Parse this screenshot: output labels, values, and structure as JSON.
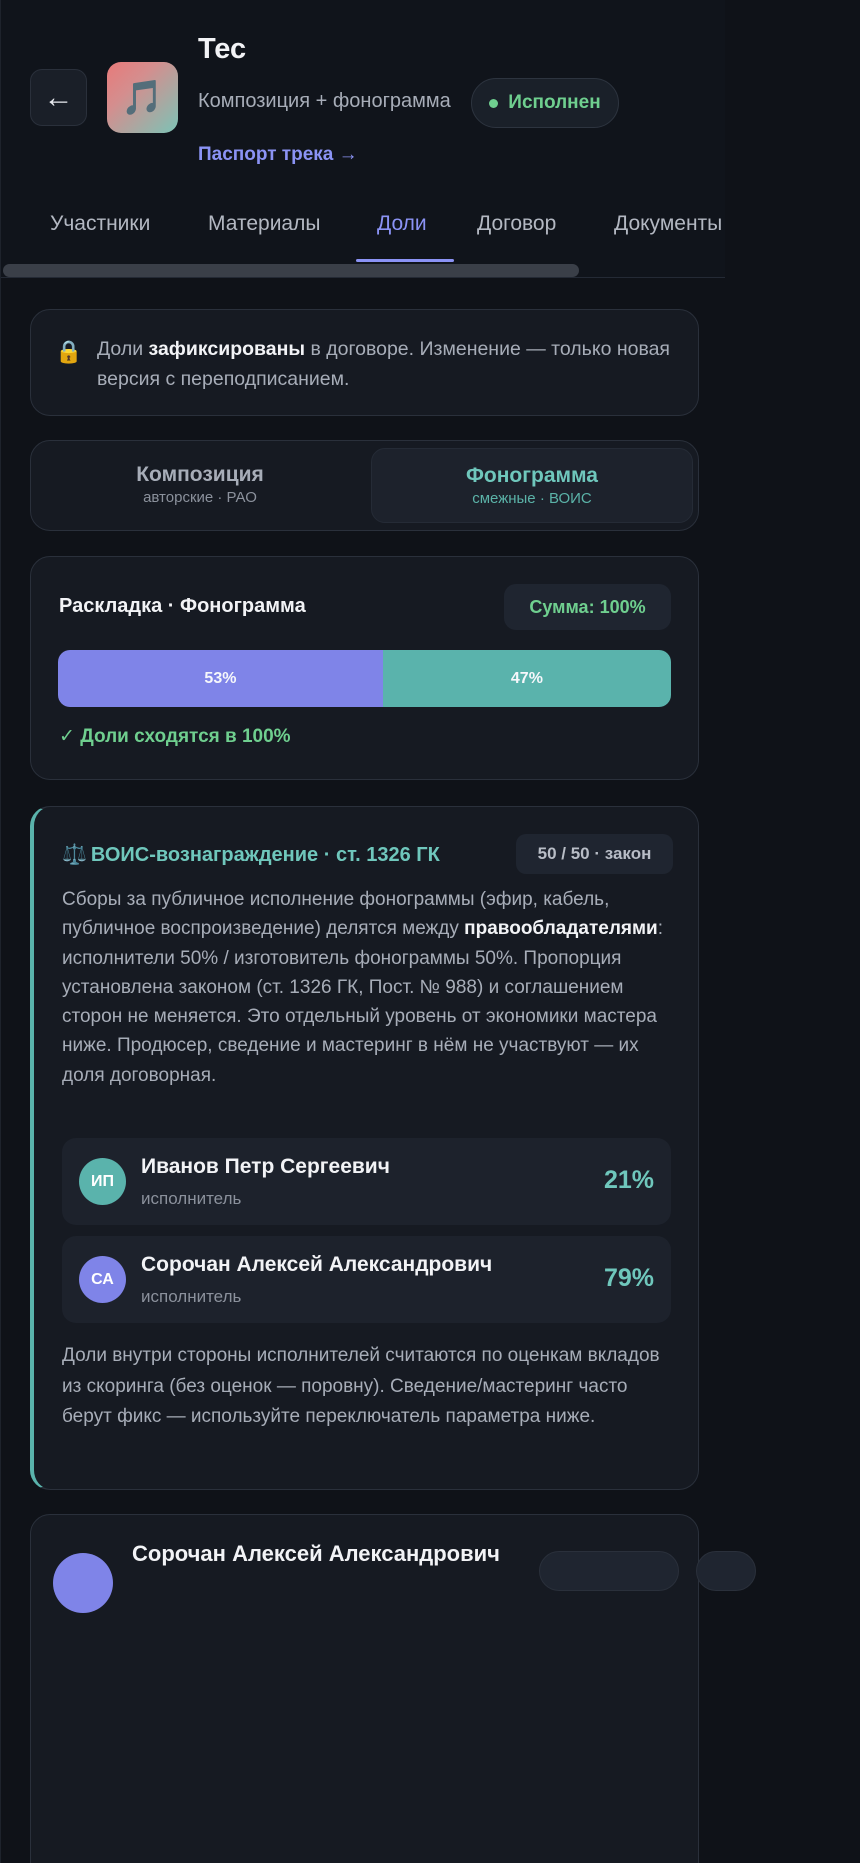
{
  "header": {
    "back_icon": "←",
    "cover_icon": "🎵",
    "title": "Тес",
    "type": "Композиция + фонограмма",
    "status": "Исполнен",
    "passport_link": "Паспорт трека →"
  },
  "tabs": [
    {
      "label": "Участники",
      "active": false
    },
    {
      "label": "Материалы",
      "active": false
    },
    {
      "label": "Доли",
      "active": true
    },
    {
      "label": "Договор",
      "active": false
    },
    {
      "label": "Документы",
      "active": false
    }
  ],
  "lock_notice": {
    "icon": "🔒",
    "prefix": "Доли ",
    "bold": "зафиксированы",
    "suffix": " в договоре. Изменение — только новая версия с переподписанием."
  },
  "rights_toggle": {
    "composition": {
      "title": "Композиция",
      "sub": "авторские · РАО",
      "active": false
    },
    "phonogram": {
      "title": "Фонограмма",
      "sub": "смежные · ВОИС",
      "active": true
    }
  },
  "split": {
    "title": "Раскладка · Фонограмма",
    "sum": "Сумма: 100%",
    "segments": [
      {
        "label": "53%",
        "value": 53,
        "color": "#7f84e8"
      },
      {
        "label": "47%",
        "value": 47,
        "color": "#5ab3ac"
      }
    ],
    "check": "✓ Доли сходятся в 100%"
  },
  "vois": {
    "icon": "⚖️",
    "title": "ВОИС-вознаграждение · ст. 1326 ГК",
    "badge": "50 / 50 · закон",
    "text_before": "Сборы за публичное исполнение фонограммы (эфир, кабель, публичное воспроизведение) делятся между ",
    "text_bold": "правообладателями",
    "text_after": ": исполнители 50% / изготовитель фонограммы 50%. Пропорция установлена законом (ст. 1326 ГК, Пост. № 988) и соглашением сторон не меняется. Это отдельный уровень от экономики мастера ниже. Продюсер, сведение и мастеринг в нём не участвуют — их доля договорная.",
    "people": [
      {
        "initials": "ИП",
        "name": "Иванов Петр Сергеевич",
        "role": "исполнитель",
        "share": "21%"
      },
      {
        "initials": "СА",
        "name": "Сорочан Алексей Александрович",
        "role": "исполнитель",
        "share": "79%"
      }
    ],
    "footnote": "Доли внутри стороны исполнителей считаются по оценкам вкладов из скоринга (без оценок — поровну). Сведение/мастеринг часто берут фикс — используйте переключатель параметра ниже."
  },
  "next_card": {
    "name": "Сорочан Алексей Александрович"
  },
  "colors": {
    "accent": "#8b93f5",
    "teal": "#6fc7bc",
    "success": "#6fcf8f"
  }
}
